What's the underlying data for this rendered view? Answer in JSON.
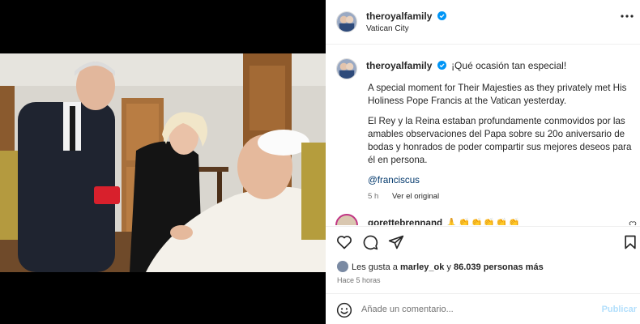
{
  "header": {
    "username": "theroyalfamily",
    "location": "Vatican City"
  },
  "caption": {
    "username": "theroyalfamily",
    "lead": "¡Qué ocasión tan especial!",
    "paragraph_en": "A special moment for Their Majesties as they privately met His Holiness Pope Francis at the Vatican yesterday.",
    "paragraph_es": "El Rey y la Reina estaban profundamente conmovidos por las amables observaciones del Papa sobre su 20o aniversario de bodas y honrados de poder compartir sus mejores deseos para él en persona.",
    "mention": "@franciscus",
    "time": "5 h",
    "see_original": "Ver el original"
  },
  "comment": {
    "username": "gorettebrennand",
    "text": "🙏👏👏👏👏👏"
  },
  "likes": {
    "prefix": "Les gusta a ",
    "user": "marley_ok",
    "middle": " y ",
    "count": "86.039 personas más"
  },
  "posted_ago": "Hace 5 horas",
  "composer": {
    "placeholder": "Añade un comentario...",
    "post_label": "Publicar"
  },
  "icons": [
    "verified-badge-icon",
    "more-options-icon",
    "heart-icon",
    "comment-icon",
    "share-icon",
    "save-icon",
    "emoji-icon"
  ],
  "colors": {
    "verified": "#0095f6",
    "link": "#00376b",
    "muted": "#737373",
    "post_disabled": "#b2dffc"
  }
}
